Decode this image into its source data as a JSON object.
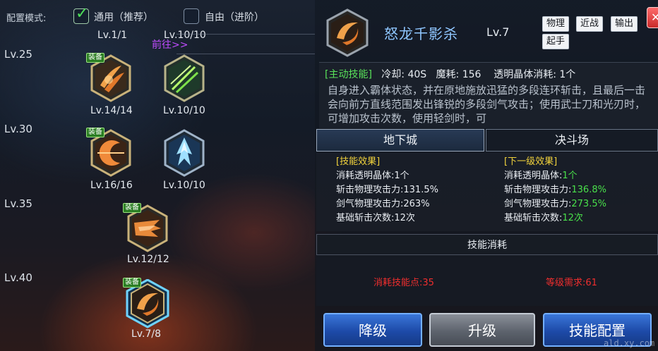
{
  "config": {
    "label": "配置模式:",
    "general_mode": "通用（推荐）",
    "free_mode": "自由（进阶）",
    "jump_link": "前往>>"
  },
  "tree": {
    "levels": [
      "Lv.25",
      "Lv.30",
      "Lv.35",
      "Lv.40"
    ],
    "top_levels": [
      "Lv.1/1",
      "Lv.10/10"
    ],
    "equip_badge": "装备",
    "nodes": [
      {
        "name": "claw-slash",
        "level": "Lv.14/14",
        "equipped": true
      },
      {
        "name": "sword-wave",
        "level": "Lv.10/10",
        "equipped": false
      },
      {
        "name": "crescent-strike",
        "level": "Lv.16/16",
        "equipped": true
      },
      {
        "name": "ice-spire",
        "level": "Lv.10/10",
        "equipped": false
      },
      {
        "name": "dragon-dash",
        "level": "Lv.12/12",
        "equipped": true
      },
      {
        "name": "dragon-shadow",
        "level": "Lv.7/8",
        "equipped": true,
        "selected": true
      }
    ]
  },
  "skill": {
    "name": "怒龙千影杀",
    "level": "Lv.7",
    "tags": [
      "物理",
      "近战",
      "输出",
      "起手"
    ],
    "active_tag": "[主动技能]",
    "cooldown_label": "冷却: 40S",
    "mana_label": "魔耗: 156",
    "crystal_label": "透明晶体消耗: 1个",
    "description": "自身进入霸体状态，并在原地施放迅猛的多段连环斩击，且最后一击会向前方直线范围发出锋锐的多段剑气攻击；使用武士刀和光刃时，可增加攻击次数，使用轻剑时，可"
  },
  "mode_tabs": [
    "地下城",
    "决斗场"
  ],
  "effects": {
    "current_title": "[技能效果]",
    "next_title": "[下一级效果]",
    "current": [
      {
        "label": "消耗透明晶体:",
        "value": "1个"
      },
      {
        "label": "斩击物理攻击力:",
        "value": "131.5%"
      },
      {
        "label": "剑气物理攻击力:",
        "value": "263%"
      },
      {
        "label": "基础斩击次数:",
        "value": "12次"
      }
    ],
    "next": [
      {
        "label": "消耗透明晶体:",
        "value": "1个"
      },
      {
        "label": "斩击物理攻击力:",
        "value": "136.8%"
      },
      {
        "label": "剑气物理攻击力:",
        "value": "273.5%"
      },
      {
        "label": "基础斩击次数:",
        "value": "12次"
      }
    ]
  },
  "cost": {
    "title": "技能消耗",
    "sp": "消耗技能点:35",
    "req": "等级需求:61"
  },
  "buttons": {
    "downgrade": "降级",
    "upgrade": "升级",
    "config": "技能配置"
  },
  "close_symbol": "✕",
  "watermark": "ald.xy.com",
  "colors": {
    "accent_blue": "#8fc6ff",
    "green": "#49e04a",
    "gold": "#f2d33c",
    "red": "#ef2e2e",
    "purple_link": "#c04cff"
  }
}
